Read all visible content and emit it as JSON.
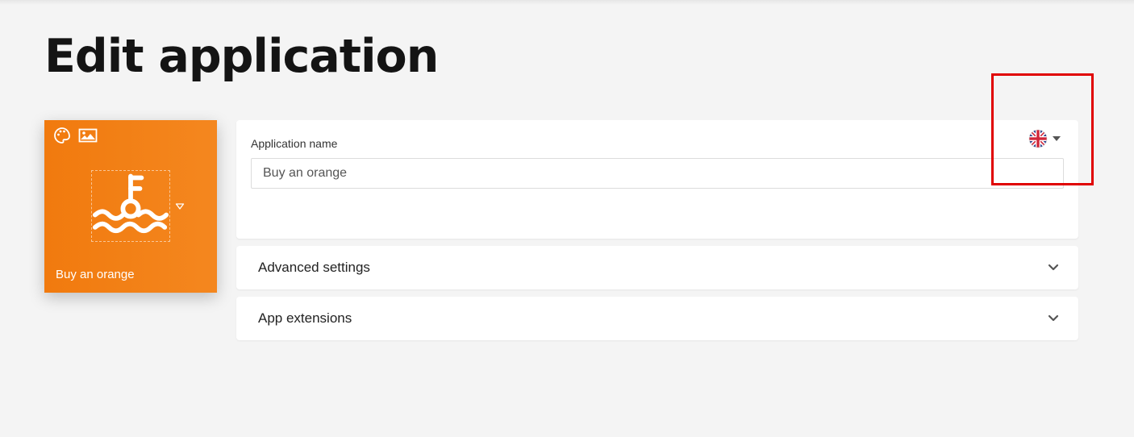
{
  "page": {
    "title": "Edit application"
  },
  "tile": {
    "app_name": "Buy an orange",
    "background_color": "#f17a0e",
    "tools": [
      {
        "icon": "palette-icon"
      },
      {
        "icon": "image-icon"
      }
    ],
    "app_icon": "key-water-icon"
  },
  "name_card": {
    "label": "Application name",
    "value": "Buy an orange",
    "language": {
      "icon": "uk-flag-icon"
    }
  },
  "sections": [
    {
      "title": "Advanced settings",
      "icon": "chevron-down-icon"
    },
    {
      "title": "App extensions",
      "icon": "chevron-down-icon"
    }
  ],
  "annotation": {
    "color": "#e00000"
  }
}
